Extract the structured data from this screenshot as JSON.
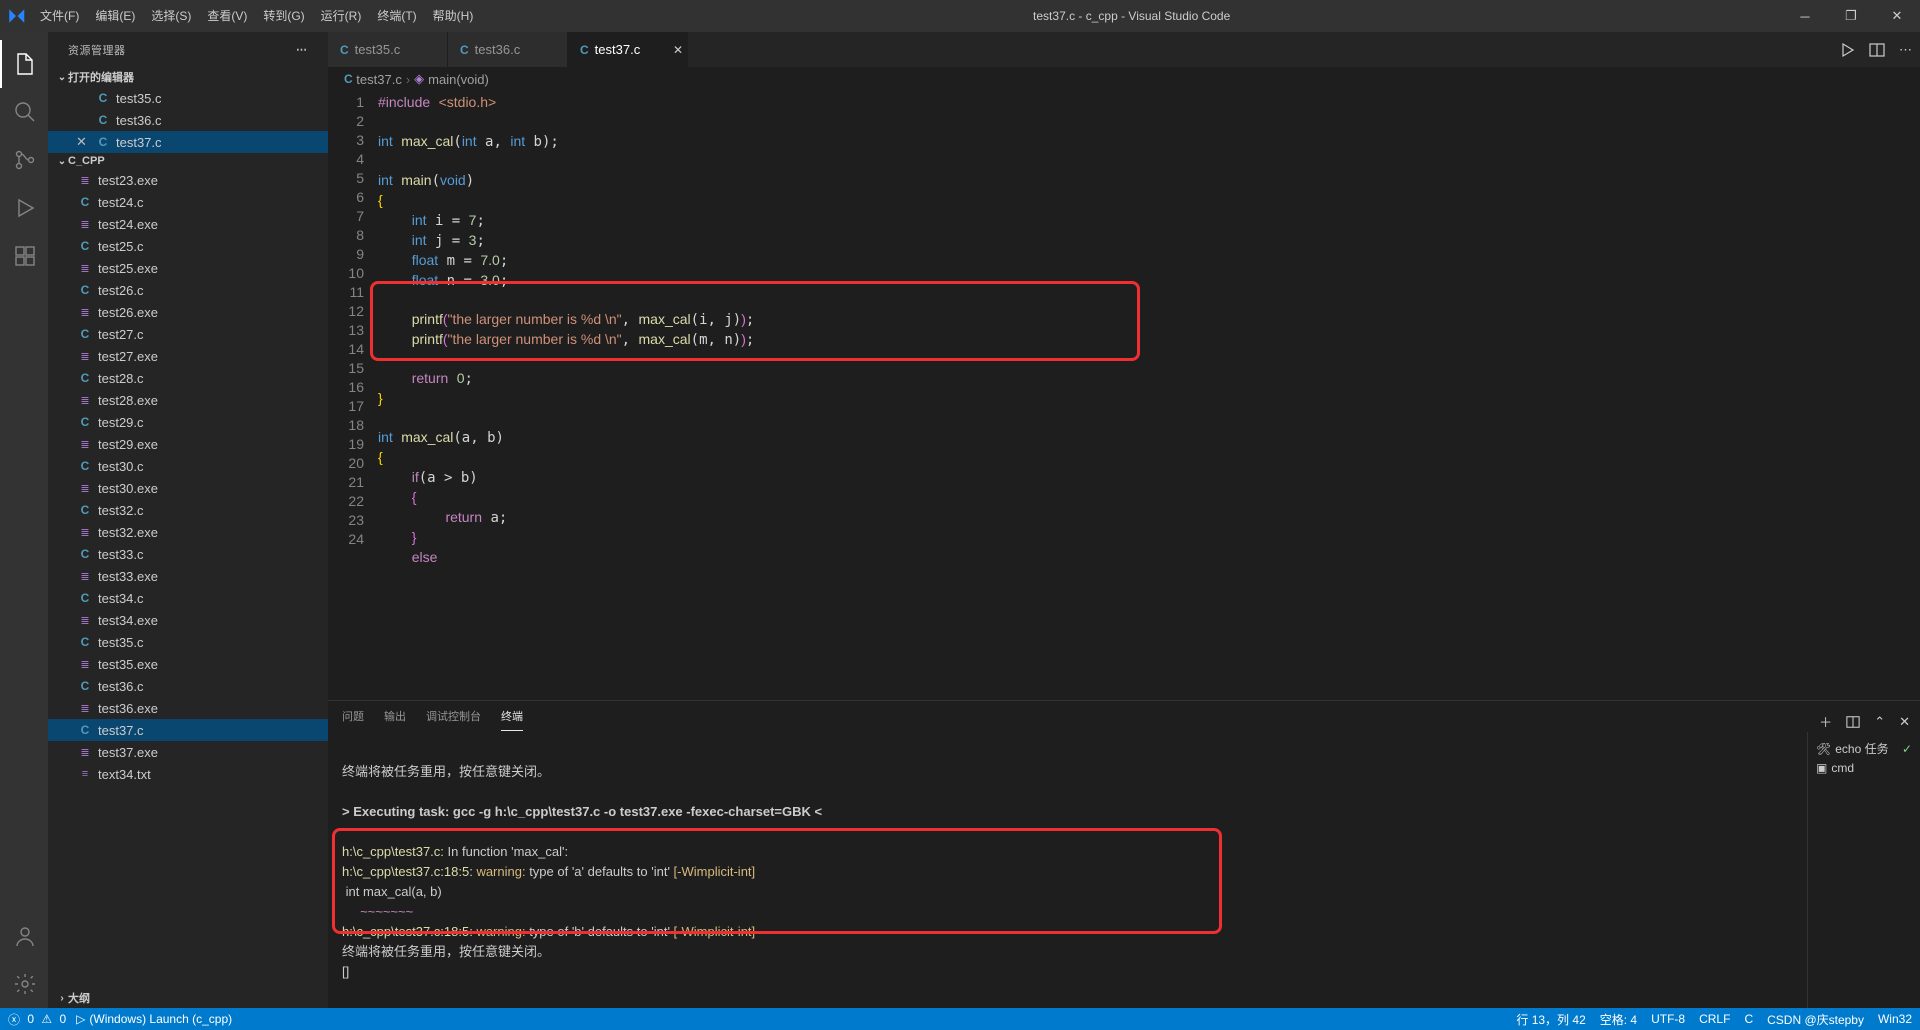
{
  "title": "test37.c - c_cpp - Visual Studio Code",
  "menu": [
    "文件(F)",
    "编辑(E)",
    "选择(S)",
    "查看(V)",
    "转到(G)",
    "运行(R)",
    "终端(T)",
    "帮助(H)"
  ],
  "sidebar": {
    "header": "资源管理器",
    "sections": {
      "openEditors": {
        "label": "打开的编辑器",
        "items": [
          {
            "icon": "c",
            "name": "test35.c",
            "close": false
          },
          {
            "icon": "c",
            "name": "test36.c",
            "close": false
          },
          {
            "icon": "c",
            "name": "test37.c",
            "close": true,
            "active": true
          }
        ]
      },
      "folder": {
        "label": "C_CPP",
        "items": [
          {
            "icon": "exe",
            "name": "test23.exe"
          },
          {
            "icon": "c",
            "name": "test24.c"
          },
          {
            "icon": "exe",
            "name": "test24.exe"
          },
          {
            "icon": "c",
            "name": "test25.c"
          },
          {
            "icon": "exe",
            "name": "test25.exe"
          },
          {
            "icon": "c",
            "name": "test26.c"
          },
          {
            "icon": "exe",
            "name": "test26.exe"
          },
          {
            "icon": "c",
            "name": "test27.c"
          },
          {
            "icon": "exe",
            "name": "test27.exe"
          },
          {
            "icon": "c",
            "name": "test28.c"
          },
          {
            "icon": "exe",
            "name": "test28.exe"
          },
          {
            "icon": "c",
            "name": "test29.c"
          },
          {
            "icon": "exe",
            "name": "test29.exe"
          },
          {
            "icon": "c",
            "name": "test30.c"
          },
          {
            "icon": "exe",
            "name": "test30.exe"
          },
          {
            "icon": "c",
            "name": "test32.c"
          },
          {
            "icon": "exe",
            "name": "test32.exe"
          },
          {
            "icon": "c",
            "name": "test33.c"
          },
          {
            "icon": "exe",
            "name": "test33.exe"
          },
          {
            "icon": "c",
            "name": "test34.c"
          },
          {
            "icon": "exe",
            "name": "test34.exe"
          },
          {
            "icon": "c",
            "name": "test35.c"
          },
          {
            "icon": "exe",
            "name": "test35.exe"
          },
          {
            "icon": "c",
            "name": "test36.c"
          },
          {
            "icon": "exe",
            "name": "test36.exe"
          },
          {
            "icon": "c",
            "name": "test37.c",
            "active": true
          },
          {
            "icon": "exe",
            "name": "test37.exe"
          },
          {
            "icon": "txt",
            "name": "text34.txt"
          }
        ]
      },
      "outline": {
        "label": "大纲"
      }
    }
  },
  "tabs": [
    {
      "icon": "c",
      "name": "test35.c"
    },
    {
      "icon": "c",
      "name": "test36.c"
    },
    {
      "icon": "c",
      "name": "test37.c",
      "active": true
    }
  ],
  "breadcrumb": {
    "file": "test37.c",
    "symbol": "main(void)"
  },
  "code": {
    "lines": [
      1,
      2,
      3,
      4,
      5,
      6,
      7,
      8,
      9,
      10,
      11,
      12,
      13,
      14,
      15,
      16,
      17,
      18,
      19,
      20,
      21,
      22,
      23,
      24
    ]
  },
  "panel": {
    "tabs": [
      "问题",
      "输出",
      "调试控制台",
      "终端"
    ],
    "activeTab": 3,
    "terminal": {
      "reuseText": "终端将被任务重用，按任意键关闭。",
      "execPrefix": "> Executing task: ",
      "execCmd": "gcc -g h:\\c_cpp\\test37.c -o test37.exe -fexec-charset=GBK <",
      "loc1": "h:\\c_cpp\\test37.c:",
      "inFunc": " In function 'max_cal':",
      "loc2": "h:\\c_cpp\\test37.c:18:5:",
      "warnWord": "warning:",
      "warnA": " type of 'a' defaults to 'int' ",
      "flag": "[-Wimplicit-int]",
      "declLine": " int max_cal(a, b)",
      "squiggle": "     ~~~~~~~",
      "warnB": " type of 'b' defaults to 'int' ",
      "cursor": "[]"
    },
    "side": [
      {
        "icon": "tools",
        "label": "echo 任务",
        "check": true
      },
      {
        "icon": "term",
        "label": "cmd"
      }
    ]
  },
  "status": {
    "errors": "0",
    "warnings": "0",
    "launch": "(Windows) Launch (c_cpp)",
    "pos": "行 13，列 42",
    "spaces": "空格: 4",
    "enc": "UTF-8",
    "eol": "CRLF",
    "lang": "C",
    "win32": "Win32",
    "notif": "CSDN @庆stepby"
  }
}
